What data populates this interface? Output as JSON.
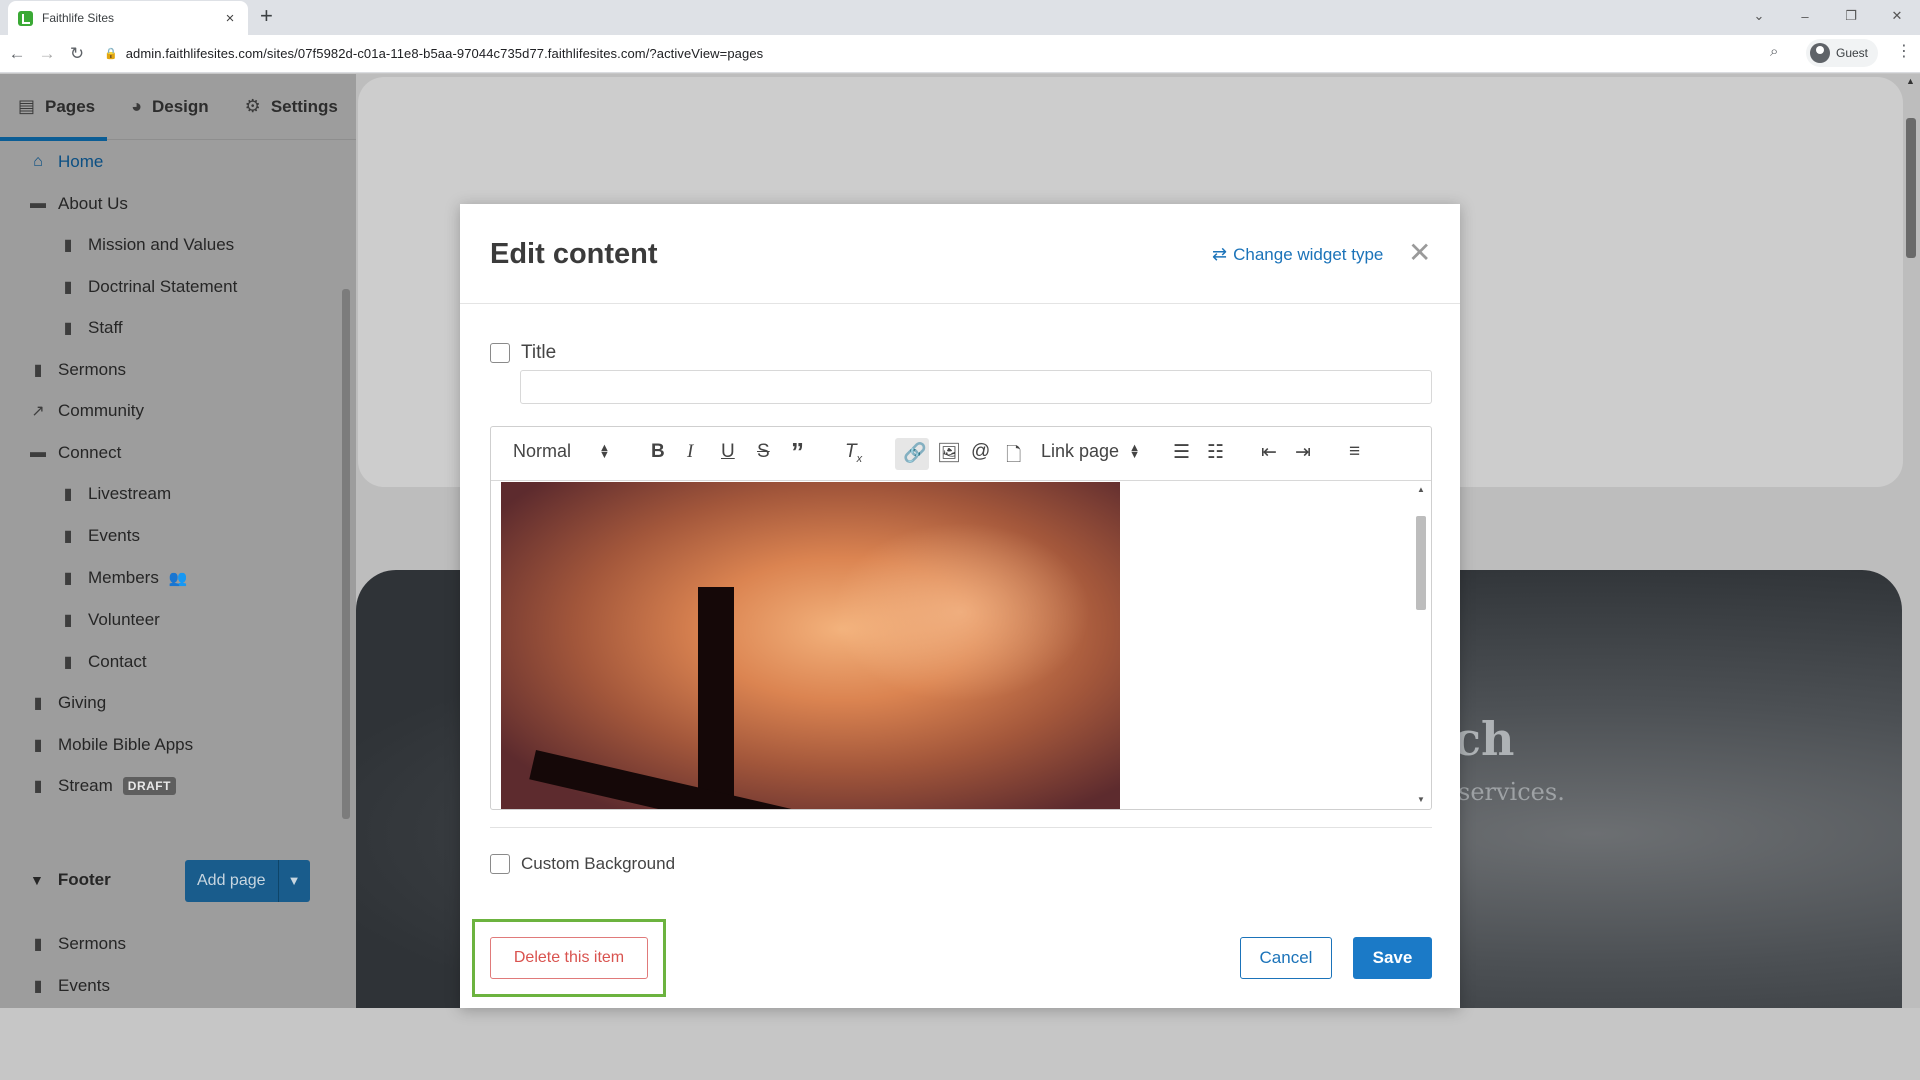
{
  "browser": {
    "tab_title": "Faithlife Sites",
    "tab_close": "×",
    "new_tab": "+",
    "url": "admin.faithlifesites.com/sites/07f5982d-c01a-11e8-b5aa-97044c735d77.faithlifesites.com/?activeView=pages",
    "profile": "Guest"
  },
  "sidebar": {
    "tabs": [
      {
        "label": "Pages",
        "icon": "file-icon"
      },
      {
        "label": "Design",
        "icon": "palette-icon"
      },
      {
        "label": "Settings",
        "icon": "gear-icon"
      }
    ],
    "items": [
      {
        "label": "Home",
        "icon": "home-icon"
      },
      {
        "label": "About Us",
        "icon": "folder-icon"
      },
      {
        "label": "Mission and Values",
        "icon": "file-icon"
      },
      {
        "label": "Doctrinal Statement",
        "icon": "file-icon"
      },
      {
        "label": "Staff",
        "icon": "file-icon"
      },
      {
        "label": "Sermons",
        "icon": "file-icon"
      },
      {
        "label": "Community",
        "icon": "external-link-icon"
      },
      {
        "label": "Connect",
        "icon": "folder-icon"
      },
      {
        "label": "Livestream",
        "icon": "file-icon"
      },
      {
        "label": "Events",
        "icon": "file-icon"
      },
      {
        "label": "Members",
        "icon": "file-icon"
      },
      {
        "label": "Volunteer",
        "icon": "file-icon"
      },
      {
        "label": "Contact",
        "icon": "file-icon"
      },
      {
        "label": "Giving",
        "icon": "file-icon"
      },
      {
        "label": "Mobile Bible Apps",
        "icon": "file-icon"
      },
      {
        "label": "Stream",
        "icon": "file-icon"
      }
    ],
    "draft_badge": "DRAFT",
    "footer_label": "Footer",
    "add_page_label": "Add page",
    "footer_items": [
      {
        "label": "Sermons",
        "icon": "file-icon"
      },
      {
        "label": "Events",
        "icon": "file-icon"
      }
    ]
  },
  "background_page": {
    "hero_title_fragment": "ch",
    "hero_subtitle_fragment": "services."
  },
  "modal": {
    "title": "Edit content",
    "change_widget_label": "Change widget type",
    "title_checkbox_label": "Title",
    "title_value": "",
    "toolbar": {
      "format_select": "Normal",
      "link_page_select": "Link page"
    },
    "custom_background_label": "Custom Background",
    "delete_label": "Delete this item",
    "cancel_label": "Cancel",
    "save_label": "Save"
  },
  "colors": {
    "accent": "#1b7ac7",
    "danger": "#d9534f",
    "highlight": "#6cb33f"
  }
}
